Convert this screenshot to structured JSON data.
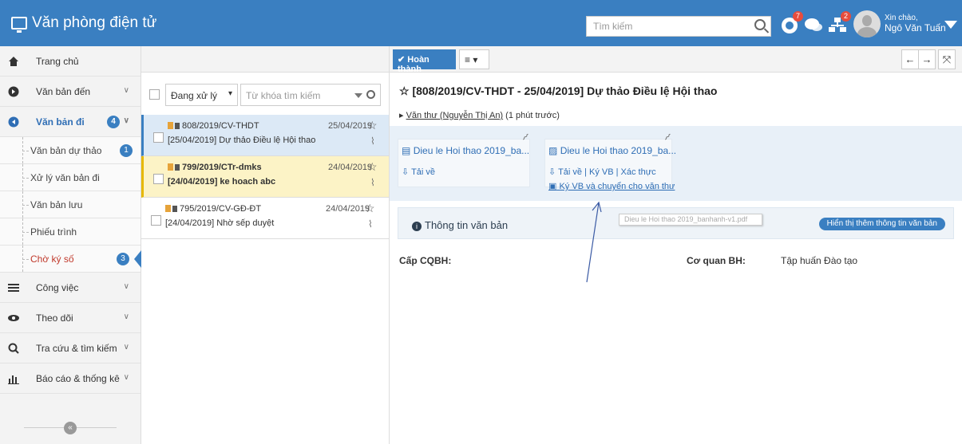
{
  "app": {
    "title": "Văn phòng điện tử"
  },
  "topbar": {
    "search_placeholder": "Tìm kiếm",
    "badges": {
      "alerts": "7",
      "tasks": "2"
    },
    "greeting": "Xin chào,",
    "user_name": "Ngô Văn Tuấn"
  },
  "sidebar": {
    "items": [
      {
        "label": "Trang chủ"
      },
      {
        "label": "Văn bản đến"
      },
      {
        "label": "Văn bản đi",
        "count": "4"
      },
      {
        "label": "Công việc"
      },
      {
        "label": "Theo dõi"
      },
      {
        "label": "Tra cứu & tìm kiếm"
      },
      {
        "label": "Báo cáo & thống kê"
      }
    ],
    "sub_items": [
      {
        "label": "Văn bản dự thảo",
        "count": "1"
      },
      {
        "label": "Xử lý văn bản đi"
      },
      {
        "label": "Văn bản lưu"
      },
      {
        "label": "Phiếu trình"
      },
      {
        "label": "Chờ ký số",
        "count": "3"
      }
    ]
  },
  "list": {
    "status_select": "Đang xử lý",
    "keyword_placeholder": "Từ khóa tìm kiếm",
    "rows": [
      {
        "number": "808/2019/CV-THDT",
        "date": "25/04/2019",
        "summary": "[25/04/2019] Dự thảo Điều lệ Hội thao"
      },
      {
        "number": "799/2019/CTr-dmks",
        "date": "24/04/2019",
        "summary": "[24/04/2019] ke hoach abc"
      },
      {
        "number": "795/2019/CV-GĐ-ĐT",
        "date": "24/04/2019",
        "summary": "[24/04/2019] Nhờ sếp duyệt"
      }
    ]
  },
  "detail": {
    "done_label": "Hoàn thành",
    "title": "☆ [808/2019/CV-THDT - 25/04/2019] Dự thảo Điều lệ Hội thao",
    "sender_name": "Văn thư (Nguyễn Thị An)",
    "sender_time": "(1 phút trước)",
    "attachments": [
      {
        "file": "Dieu le Hoi thao 2019_ba...",
        "actions": "Tải về"
      },
      {
        "file": "Dieu le Hoi thao 2019_ba...",
        "actions": "Tải về | Ký VB | Xác thực",
        "extra": "Ký VB và chuyển cho văn thư"
      }
    ],
    "tooltip": "Dieu le Hoi thao 2019_banhanh-v1.pdf",
    "info_title": "Thông tin văn bản",
    "more_info_button": "Hiển thị thêm thông tin văn bản",
    "fields": {
      "cap_label": "Cấp CQBH:",
      "coquan_label": "Cơ quan BH:",
      "coquan_value": "Tập huấn Đào tạo"
    }
  },
  "colors": {
    "primary": "#3a7fc1",
    "selected_row": "#dce9f6",
    "highlight_row": "#fcf3c6",
    "badge_red": "#e74c3c"
  }
}
